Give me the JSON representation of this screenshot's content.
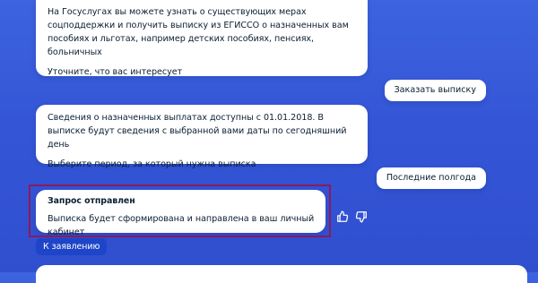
{
  "messages": {
    "bot1": {
      "text": "На Госуслугах вы можете узнать о существующих мерах соцподдержки и получить выписку из ЕГИССО о назначенных вам пособиях и льготах, например детских пособиях, пенсиях, больничных",
      "sub": "Уточните, что вас интересует"
    },
    "user1": "Заказать выписку",
    "bot2": {
      "text": "Сведения о назначенных выплатах доступны с 01.01.2018. В выписке будут сведения с выбранной вами даты по сегодняшний день",
      "sub": "Выберите период, за который нужна выписка"
    },
    "user2": "Последние полгода",
    "bot3": {
      "title": "Запрос отправлен",
      "text": "Выписка будет сформирована и направлена в ваш личный кабинет"
    }
  },
  "actions": {
    "open_application": "К заявлению"
  },
  "icons": {
    "like": "thumbs-up-icon",
    "dislike": "thumbs-down-icon"
  },
  "colors": {
    "background": "#3456d6",
    "bubble": "#ffffff",
    "button": "#1e45c8",
    "highlight": "#8b1a5c"
  }
}
